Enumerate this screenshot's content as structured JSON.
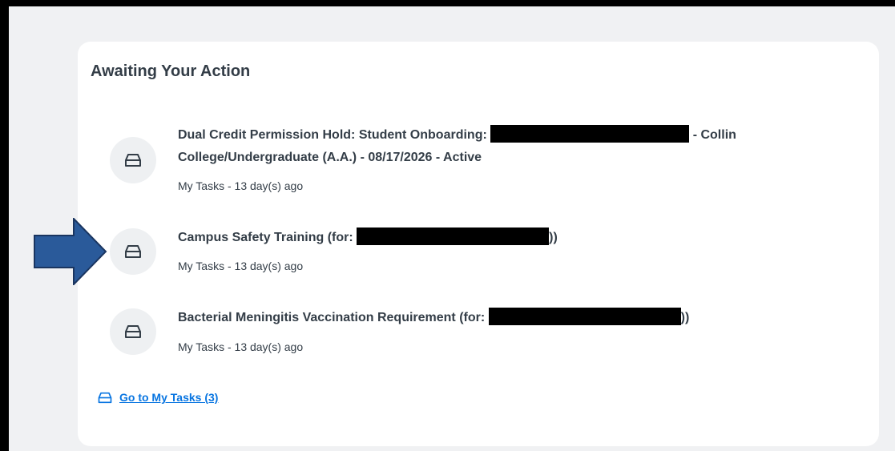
{
  "card": {
    "title": "Awaiting Your Action"
  },
  "tasks": [
    {
      "title_line1_prefix": "Dual Credit Permission Hold: Student Onboarding:",
      "title_line1_suffix": "- Collin",
      "title_line2": "College/Undergraduate (A.A.) - 08/17/2026 - Active",
      "meta": "My Tasks - 13 day(s) ago",
      "icon": "inbox-tray-icon"
    },
    {
      "title_prefix": "Campus Safety Training (for:",
      "title_suffix": "))",
      "meta": "My Tasks - 13 day(s) ago",
      "icon": "inbox-tray-icon"
    },
    {
      "title_prefix": "Bacterial Meningitis Vaccination Requirement (for:",
      "title_suffix": "))",
      "meta": "My Tasks - 13 day(s) ago",
      "icon": "inbox-tray-icon"
    }
  ],
  "footer": {
    "go_to_tasks_label": "Go to My Tasks (3)",
    "icon": "inbox-tray-icon"
  },
  "annotation": {
    "icon": "right-arrow-icon",
    "color": "#2a5a9a"
  },
  "colors": {
    "text": "#333d47",
    "link": "#0875e1",
    "background": "#f0f1f3",
    "card": "#ffffff"
  }
}
